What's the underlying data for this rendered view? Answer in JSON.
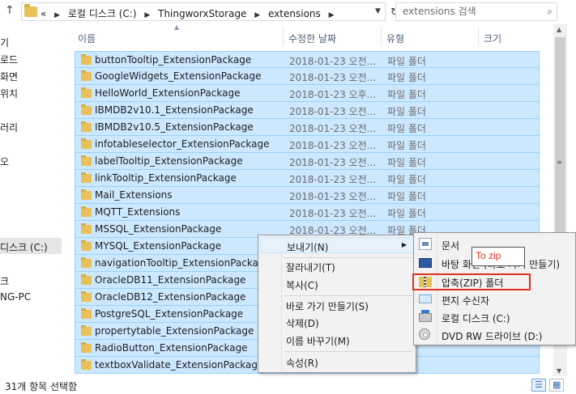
{
  "address": {
    "prefix": "«",
    "crumbs": [
      "로컬 디스크 (C:)",
      "ThingworxStorage",
      "extensions"
    ]
  },
  "search": {
    "placeholder": "extensions 검색"
  },
  "nav": {
    "items": [
      "기",
      "로드",
      "화면",
      "위치",
      "러리",
      "오",
      "디스크 (C:)",
      "크",
      "NG-PC"
    ]
  },
  "columns": {
    "name": "이름",
    "date": "수정한 날짜",
    "type": "유형",
    "size": "크기"
  },
  "files": [
    {
      "name": "buttonTooltip_ExtensionPackage",
      "date": "2018-01-23 오전...",
      "type": "파일 폴더"
    },
    {
      "name": "GoogleWidgets_ExtensionPackage",
      "date": "2018-01-23 오전...",
      "type": "파일 폴더"
    },
    {
      "name": "HelloWorld_ExtensionPackage",
      "date": "2018-01-23 오후...",
      "type": "파일 폴더"
    },
    {
      "name": "IBMDB2v10.1_ExtensionPackage",
      "date": "2018-01-23 오전...",
      "type": "파일 폴더"
    },
    {
      "name": "IBMDB2v10.5_ExtensionPackage",
      "date": "2018-01-23 오전...",
      "type": "파일 폴더"
    },
    {
      "name": "infotableselector_ExtensionPackage",
      "date": "2018-01-23 오전...",
      "type": "파일 폴더"
    },
    {
      "name": "labelTooltip_ExtensionPackage",
      "date": "2018-01-23 오전...",
      "type": "파일 폴더"
    },
    {
      "name": "linkTooltip_ExtensionPackage",
      "date": "2018-01-23 오전...",
      "type": "파일 폴더"
    },
    {
      "name": "Mail_Extensions",
      "date": "2018-01-23 오전...",
      "type": "파일 폴더"
    },
    {
      "name": "MQTT_Extensions",
      "date": "2018-01-23 오전...",
      "type": "파일 폴더"
    },
    {
      "name": "MSSQL_ExtensionPackage",
      "date": "2018-01-23 오전...",
      "type": "파일 폴더"
    },
    {
      "name": "MYSQL_ExtensionPackage",
      "date": "",
      "type": ""
    },
    {
      "name": "navigationTooltip_ExtensionPackage",
      "date": "",
      "type": ""
    },
    {
      "name": "OracleDB11_ExtensionPackage",
      "date": "",
      "type": ""
    },
    {
      "name": "OracleDB12_ExtensionPackage",
      "date": "",
      "type": ""
    },
    {
      "name": "PostgreSQL_ExtensionPackage",
      "date": "",
      "type": ""
    },
    {
      "name": "propertytable_ExtensionPackage",
      "date": "",
      "type": ""
    },
    {
      "name": "RadioButton_ExtensionPackage",
      "date": "",
      "type": ""
    },
    {
      "name": "textboxValidate_ExtensionPackage",
      "date": "",
      "type": ""
    }
  ],
  "context_menu": {
    "send_to": "보내기(N)",
    "cut": "잘라내기(T)",
    "copy": "복사(C)",
    "create_shortcut": "바로 가기 만들기(S)",
    "delete": "삭제(D)",
    "rename": "이름 바꾸기(M)",
    "properties": "속성(R)"
  },
  "submenu": {
    "documents": "문서",
    "desktop": "바탕 화면 (바로 가기 만들기)",
    "zip": "압축(ZIP) 폴더",
    "mail": "편지 수신자",
    "local_disk": "로컬 디스크 (C:)",
    "dvd": "DVD RW 드라이브 (D:)"
  },
  "annotation": {
    "text": "To zip"
  },
  "status": {
    "text": "31개 항목 선택함"
  },
  "colors": {
    "selection": "#cce8ff",
    "annotation": "#e0301e"
  }
}
